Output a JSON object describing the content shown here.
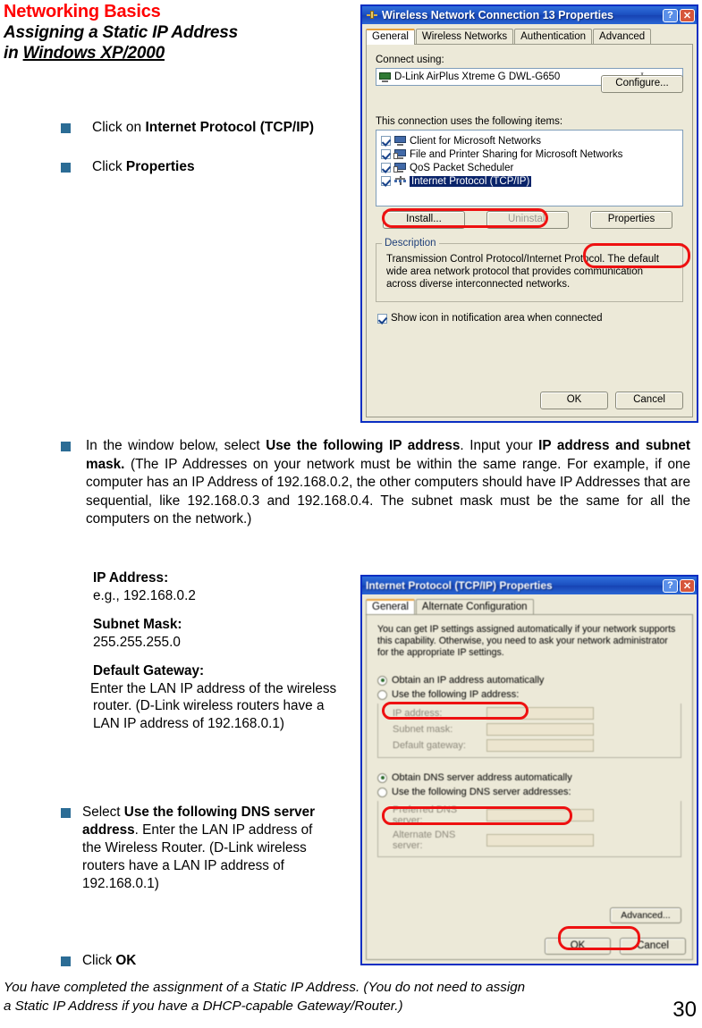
{
  "page": {
    "number": "30",
    "heading_red": "Networking Basics",
    "heading_line1": "Assigning a Static IP Address",
    "heading_line2_pre": "in ",
    "heading_line2_underlined": "Windows XP/2000",
    "footer_line1": "You have completed the assignment of a Static IP Address.  (You do not need to assign",
    "footer_line2": "a Static IP Address if you have a DHCP-capable Gateway/Router.)",
    "bullet_color": "#2b6c95",
    "accent_red": "#ff0000",
    "highlight_red": "#ee1111"
  },
  "steps": {
    "step1_pre": "Click on ",
    "step1_bold": "Internet Protocol (TCP/IP)",
    "step2_pre": "Click ",
    "step2_bold": "Properties",
    "step3_a": "In the window below, select ",
    "step3_b": "Use the following IP address",
    "step3_c": ". Input your ",
    "step3_d": "IP address and subnet mask.",
    "step3_e": " (The IP Addresses on your network must be within the same range. For example, if one computer has an IP Address of 192.168.0.2, the other computers should have IP Addresses that are sequential, like 192.168.0.3 and 192.168.0.4.  The subnet mask must be the same for all the computers on the network.)",
    "step4_a": "Select ",
    "step4_b": "Use the following DNS server address",
    "step4_c": ".  Enter the LAN IP address of the Wireless Router.  (D-Link wireless routers have a LAN IP address of 192.168.0.1)",
    "step5_pre": "Click ",
    "step5_bold": "OK"
  },
  "ipinfo": {
    "ip_label": "IP Address:",
    "ip_value": "e.g., 192.168.0.2",
    "mask_label": "Subnet Mask:",
    "mask_value": "255.255.255.0",
    "gw_label": "Default Gateway:",
    "gw_value": "Enter the LAN IP address of the wireless router. (D-Link wireless routers have a LAN IP address of 192.168.0.1)"
  },
  "dialog1": {
    "title": "Wireless Network Connection 13 Properties",
    "help_btn": "?",
    "close_btn": "✕",
    "tabs": [
      {
        "label": "General",
        "active": true
      },
      {
        "label": "Wireless Networks",
        "active": false
      },
      {
        "label": "Authentication",
        "active": false
      },
      {
        "label": "Advanced",
        "active": false
      }
    ],
    "connect_using_label": "Connect using:",
    "adapter": "D-Link AirPlus Xtreme G DWL-G650",
    "configure_btn": "Configure...",
    "items_label": "This connection uses the following items:",
    "items": [
      {
        "label": "Client for Microsoft Networks",
        "checked": true,
        "selected": false
      },
      {
        "label": "File and Printer Sharing for Microsoft Networks",
        "checked": true,
        "selected": false
      },
      {
        "label": "QoS Packet Scheduler",
        "checked": true,
        "selected": false
      },
      {
        "label": "Internet Protocol (TCP/IP)",
        "checked": true,
        "selected": true
      }
    ],
    "install_btn": "Install...",
    "uninstall_btn": "Uninstall",
    "properties_btn": "Properties",
    "description_label": "Description",
    "description_text": "Transmission Control Protocol/Internet Protocol. The default wide area network protocol that provides communication across diverse interconnected networks.",
    "show_icon_label": "Show icon in notification area when connected",
    "show_icon_checked": true,
    "ok_btn": "OK",
    "cancel_btn": "Cancel"
  },
  "dialog2": {
    "title": "Internet Protocol (TCP/IP) Properties",
    "help_btn": "?",
    "close_btn": "✕",
    "tabs": [
      {
        "label": "General",
        "active": true
      },
      {
        "label": "Alternate Configuration",
        "active": false
      }
    ],
    "intro": "You can get IP settings assigned automatically if your network supports this capability. Otherwise, you need to ask your network administrator for the appropriate IP settings.",
    "radio_auto_ip": "Obtain an IP address automatically",
    "radio_static_ip": "Use the following IP address:",
    "field_ip": "IP address:",
    "field_mask": "Subnet mask:",
    "field_gw": "Default gateway:",
    "radio_auto_dns": "Obtain DNS server address automatically",
    "radio_static_dns": "Use the following DNS server addresses:",
    "field_pref_dns": "Preferred DNS server:",
    "field_alt_dns": "Alternate DNS server:",
    "advanced_btn": "Advanced...",
    "ok_btn": "OK",
    "cancel_btn": "Cancel"
  }
}
